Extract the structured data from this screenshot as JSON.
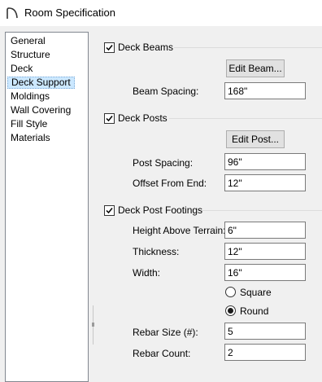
{
  "window": {
    "title": "Room Specification",
    "icon": "room-arc-icon"
  },
  "nav": {
    "items": [
      {
        "label": "General"
      },
      {
        "label": "Structure"
      },
      {
        "label": "Deck"
      },
      {
        "label": "Deck Support",
        "selected": true
      },
      {
        "label": "Moldings"
      },
      {
        "label": "Wall Covering"
      },
      {
        "label": "Fill Style"
      },
      {
        "label": "Materials"
      }
    ]
  },
  "deck_beams": {
    "label": "Deck Beams",
    "checked": true,
    "edit_button": "Edit Beam...",
    "beam_spacing": {
      "label": "Beam Spacing:",
      "value": "168\""
    }
  },
  "deck_posts": {
    "label": "Deck Posts",
    "checked": true,
    "edit_button": "Edit Post...",
    "post_spacing": {
      "label": "Post Spacing:",
      "value": "96\""
    },
    "offset_from_end": {
      "label": "Offset From End:",
      "value": "12\""
    }
  },
  "footings": {
    "label": "Deck Post Footings",
    "checked": true,
    "height_above_terrain": {
      "label": "Height Above Terrain:",
      "value": "6\""
    },
    "thickness": {
      "label": "Thickness:",
      "value": "12\""
    },
    "width": {
      "label": "Width:",
      "value": "16\""
    },
    "shape": {
      "options": [
        "Square",
        "Round"
      ],
      "selected": "Round"
    },
    "rebar_size": {
      "label": "Rebar Size (#):",
      "value": "5"
    },
    "rebar_count": {
      "label": "Rebar Count:",
      "value": "2"
    }
  },
  "colors": {
    "selection": "#cce8ff",
    "button": "#e1e1e1",
    "background": "#f0f0f0"
  }
}
